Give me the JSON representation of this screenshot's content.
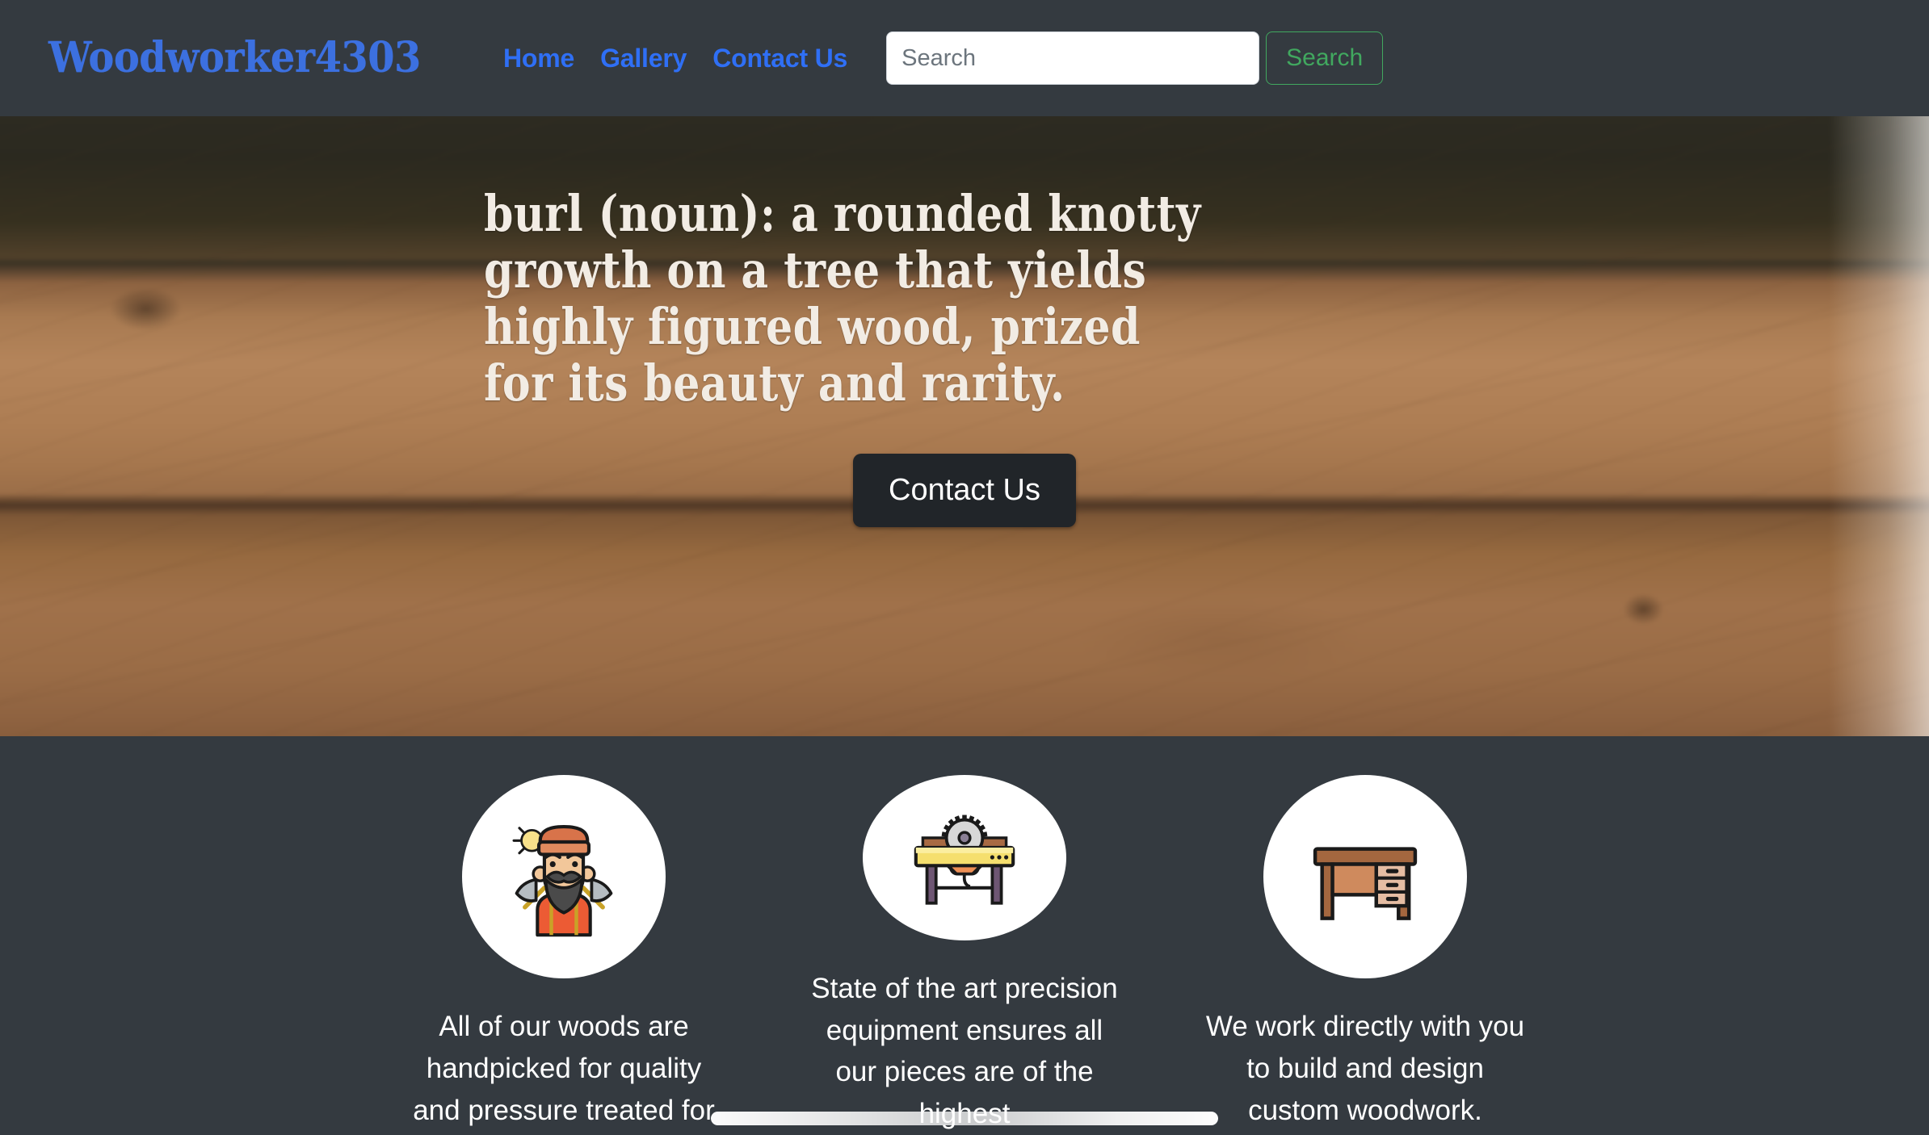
{
  "navbar": {
    "brand": "Woodworker4303",
    "links": [
      {
        "label": "Home",
        "name": "nav-link-home"
      },
      {
        "label": "Gallery",
        "name": "nav-link-gallery"
      },
      {
        "label": "Contact Us",
        "name": "nav-link-contact-us"
      }
    ],
    "search": {
      "placeholder": "Search",
      "value": "",
      "button_label": "Search",
      "button_color": "#41a85f"
    },
    "background_color": "#343a40",
    "link_color": "#2f6ff5",
    "brand_color": "#3c70e0"
  },
  "hero": {
    "headline": "burl (noun): a rounded knotty growth on a tree that yields highly figured wood, prized for its beauty and rarity.",
    "cta_label": "Contact Us",
    "cta_background": "#212529",
    "text_color": "#f2ece4"
  },
  "features": {
    "background_color": "#343a40",
    "items": [
      {
        "icon": "lumberjack-icon",
        "text": "All of our woods are handpicked for quality and pressure treated for"
      },
      {
        "icon": "table-saw-icon",
        "text": "State of the art precision equipment ensures all our pieces are of the highest"
      },
      {
        "icon": "wooden-desk-icon",
        "text": "We work directly with you to build and design custom woodwork."
      }
    ]
  },
  "scrollbar": {
    "orientation": "horizontal",
    "color": "#ffffff"
  }
}
